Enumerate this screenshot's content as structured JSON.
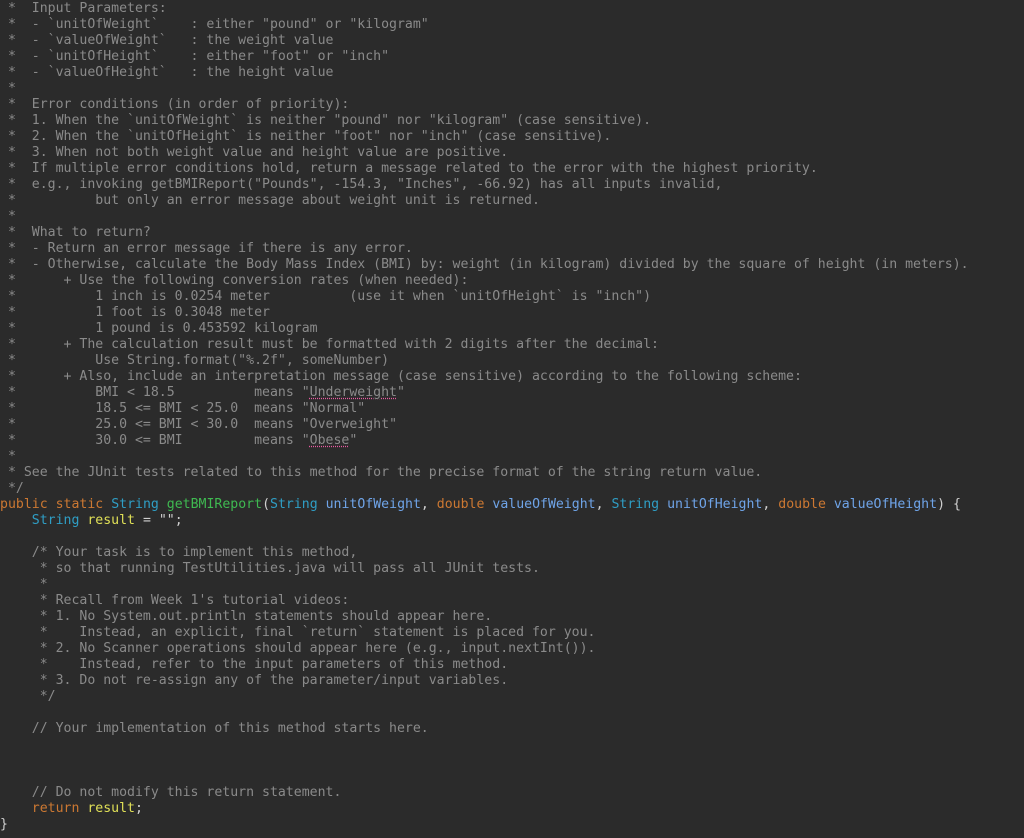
{
  "javadoc": {
    "lines": [
      " *  Input Parameters:",
      " *  - `unitOfWeight`    : either \"pound\" or \"kilogram\"",
      " *  - `valueOfWeight`   : the weight value",
      " *  - `unitOfHeight`    : either \"foot\" or \"inch\"",
      " *  - `valueOfHeight`   : the height value",
      " *",
      " *  Error conditions (in order of priority):",
      " *  1. When the `unitOfWeight` is neither \"pound\" nor \"kilogram\" (case sensitive).",
      " *  2. When the `unitOfHeight` is neither \"foot\" nor \"inch\" (case sensitive).",
      " *  3. When not both weight value and height value are positive.",
      " *  If multiple error conditions hold, return a message related to the error with the highest priority.",
      " *  e.g., invoking getBMIReport(\"Pounds\", -154.3, \"Inches\", -66.92) has all inputs invalid,",
      " *          but only an error message about weight unit is returned.",
      " *",
      " *  What to return?",
      " *  - Return an error message if there is any error.",
      " *  - Otherwise, calculate the Body Mass Index (BMI) by: weight (in kilogram) divided by the square of height (in meters).",
      " *      + Use the following conversion rates (when needed):",
      " *          1 inch is 0.0254 meter          (use it when `unitOfHeight` is \"inch\")",
      " *          1 foot is 0.3048 meter",
      " *          1 pound is 0.453592 kilogram",
      " *      + The calculation result must be formatted with 2 digits after the decimal:",
      " *          Use String.format(\"%.2f\", someNumber)",
      " *      + Also, include an interpretation message (case sensitive) according to the following scheme:"
    ],
    "bmi_scheme": [
      {
        "range": " *          BMI < 18.5          means \"",
        "label": "Underweight",
        "squiggle": true
      },
      {
        "range": " *          18.5 <= BMI < 25.0  means \"",
        "label": "Normal",
        "squiggle": false
      },
      {
        "range": " *          25.0 <= BMI < 30.0  means \"",
        "label": "Overweight",
        "squiggle": false
      },
      {
        "range": " *          30.0 <= BMI         means \"",
        "label": "Obese",
        "squiggle": true
      }
    ],
    "after_scheme": [
      " *",
      " * See the JUnit tests related to this method for the precise format of the string return value.",
      " */"
    ]
  },
  "signature": {
    "public": "public",
    "static": "static",
    "return_type": "String",
    "method_name": "getBMIReport",
    "params": [
      {
        "type": "String",
        "name": "unitOfWeight",
        "type_kind": "ty"
      },
      {
        "type": "double",
        "name": "valueOfWeight",
        "type_kind": "kw"
      },
      {
        "type": "String",
        "name": "unitOfHeight",
        "type_kind": "ty"
      },
      {
        "type": "double",
        "name": "valueOfHeight",
        "type_kind": "kw"
      }
    ],
    "open_brace": ") {"
  },
  "body": {
    "decl_type": "String",
    "decl_var": "result",
    "decl_rest": " = \"\";",
    "block_comment": [
      "    /* Your task is to implement this method,",
      "     * so that running TestUtilities.java will pass all JUnit tests.",
      "     *",
      "     * Recall from Week 1's tutorial videos:",
      "     * 1. No System.out.println statements should appear here.",
      "     *    Instead, an explicit, final `return` statement is placed for you.",
      "     * 2. No Scanner operations should appear here (e.g., input.nextInt()).",
      "     *    Instead, refer to the input parameters of this method.",
      "     * 3. Do not re-assign any of the parameter/input variables.",
      "     */"
    ],
    "impl_comment": "    // Your implementation of this method starts here.",
    "return_comment": "    // Do not modify this return statement.",
    "return_kw": "return",
    "return_var": "result",
    "closing_brace": "}"
  },
  "colors": {
    "background": "#2b2b2b",
    "comment": "#8a8a8a",
    "keyword": "#cc7832",
    "type": "#2f9ec5",
    "method": "#3fb951",
    "param": "#6fa4e8",
    "variable": "#e0e057",
    "squiggle": "#e85aa0"
  }
}
